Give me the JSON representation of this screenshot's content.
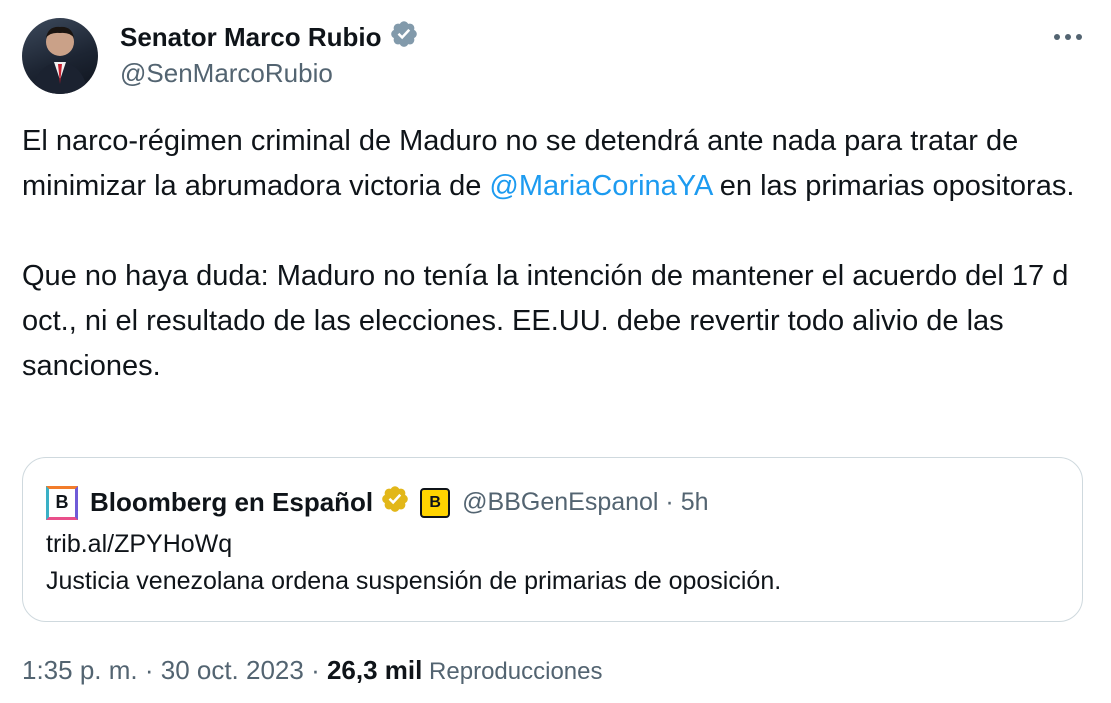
{
  "author": {
    "name": "Senator Marco Rubio",
    "handle": "@SenMarcoRubio",
    "verified_color": "#829aab"
  },
  "tweet": {
    "paragraph1_a": "El narco-régimen criminal de Maduro no se detendrá ante nada para tratar de minimizar la abrumadora victoria de ",
    "mention": "@MariaCorinaYA",
    "paragraph1_b": " en las primarias opositoras.",
    "paragraph2": "Que no haya duda: Maduro no tenía la intención de mantener el acuerdo del 17 d oct., ni el resultado de las elecciones. EE.UU. debe revertir todo alivio de las sanciones."
  },
  "quote": {
    "logo_letter": "B",
    "name": "Bloomberg en Español",
    "affiliate_letter": "B",
    "handle": "@BBGenEspanol",
    "separator": " · ",
    "time": "5h",
    "link": "trib.al/ZPYHoWq",
    "text": "Justicia venezolana ordena suspensión de primarias de oposición."
  },
  "footer": {
    "time": "1:35 p. m.",
    "sep": " · ",
    "date": "30 oct. 2023",
    "sep2": " · ",
    "views_count": "26,3 mil",
    "views_label": " Reproducciones"
  },
  "colors": {
    "accent": "#1d9bf0",
    "secondary_text": "#536471",
    "border": "#cfd9de",
    "gold_badge": "#e2b719"
  }
}
